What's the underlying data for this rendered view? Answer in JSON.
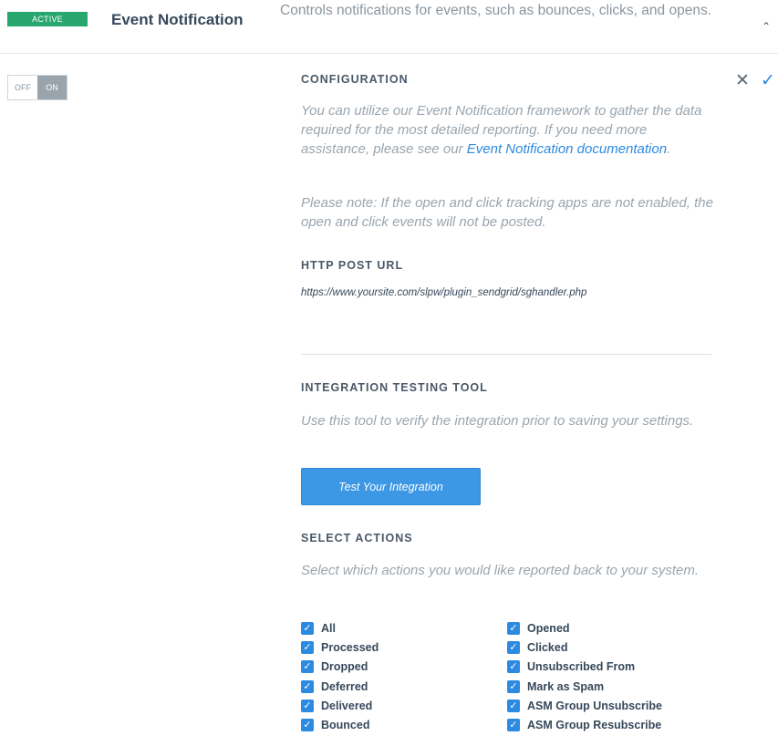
{
  "header": {
    "badge": "ACTIVE",
    "title": "Event Notification",
    "description": "Controls notifications for events, such as bounces, clicks, and opens.",
    "collapse_icon": "chevron-up-icon"
  },
  "toggle": {
    "off_label": "OFF",
    "on_label": "ON",
    "state": "ON"
  },
  "controls": {
    "cancel_icon": "close-icon",
    "confirm_icon": "check-icon"
  },
  "configuration": {
    "title": "CONFIGURATION",
    "intro_prefix": "You can utilize our Event Notification framework to gather the data required for the most detailed reporting. If you need more assistance, please see our ",
    "link_text": "Event Notification documentation",
    "intro_suffix": ".",
    "note": "Please note: If the open and click tracking apps are not enabled, the open and click events will not be posted."
  },
  "http_post": {
    "title": "HTTP POST URL",
    "url": "https://www.yoursite.com/slpw/plugin_sendgrid/sghandler.php"
  },
  "testing": {
    "title": "INTEGRATION TESTING TOOL",
    "description": "Use this tool to verify the integration prior to saving your settings.",
    "button_label": "Test Your Integration"
  },
  "actions": {
    "title": "SELECT ACTIONS",
    "description": "Select which actions you would like reported back to your system.",
    "col1": [
      {
        "label": "All",
        "checked": true
      },
      {
        "label": "Processed",
        "checked": true
      },
      {
        "label": "Dropped",
        "checked": true
      },
      {
        "label": "Deferred",
        "checked": true
      },
      {
        "label": "Delivered",
        "checked": true
      },
      {
        "label": "Bounced",
        "checked": true
      }
    ],
    "col2": [
      {
        "label": "Opened",
        "checked": true
      },
      {
        "label": "Clicked",
        "checked": true
      },
      {
        "label": "Unsubscribed From",
        "checked": true
      },
      {
        "label": "Mark as Spam",
        "checked": true
      },
      {
        "label": "ASM Group Unsubscribe",
        "checked": true
      },
      {
        "label": "ASM Group Resubscribe",
        "checked": true
      }
    ]
  },
  "colors": {
    "accent": "#2c8ae0",
    "active_badge": "#27a76f",
    "button": "#3c97e4"
  }
}
